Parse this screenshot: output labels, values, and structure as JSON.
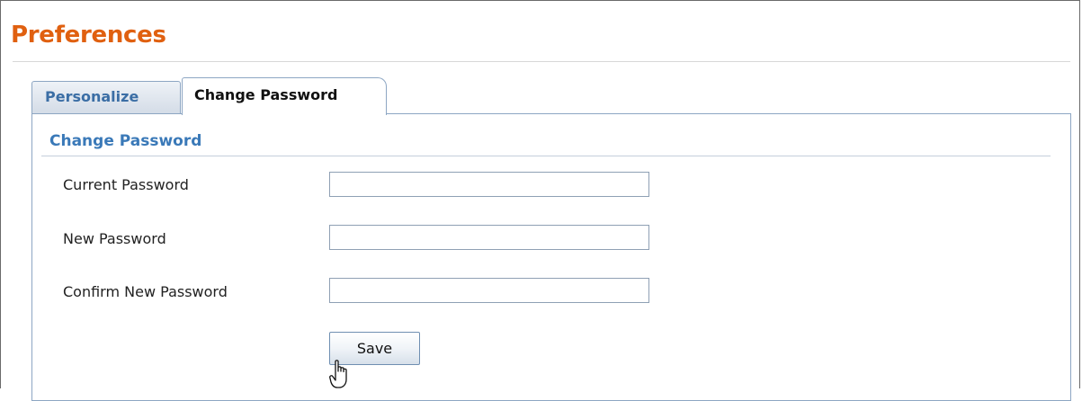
{
  "page": {
    "title": "Preferences"
  },
  "tabs": [
    {
      "label": "Personalize",
      "active": false
    },
    {
      "label": "Change Password",
      "active": true
    }
  ],
  "section": {
    "title": "Change Password"
  },
  "fields": [
    {
      "label": "Current Password",
      "value": "",
      "type": "password"
    },
    {
      "label": "New Password",
      "value": "",
      "type": "password"
    },
    {
      "label": "Confirm New Password",
      "value": "",
      "type": "password"
    }
  ],
  "actions": {
    "save_label": "Save"
  },
  "colors": {
    "title": "#e06010",
    "section_title": "#3a79b8",
    "tab_inactive_text": "#3b6ea5",
    "tab_border": "#8da6c3"
  },
  "icons": {
    "cursor": "hand-pointer-icon"
  }
}
